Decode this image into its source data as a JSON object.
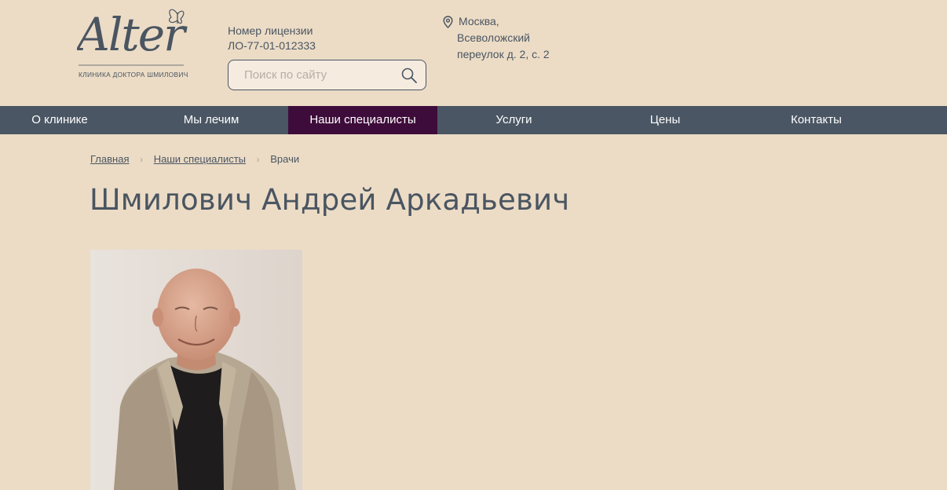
{
  "header": {
    "logo_text": "Alter",
    "logo_subtitle": "КЛИНИКА ДОКТОРА ШМИЛОВИЧА",
    "license_label": "Номер лицензии",
    "license_number": "ЛО-77-01-012333",
    "search": {
      "placeholder": "Поиск по сайту",
      "value": ""
    },
    "address": {
      "line1": "Москва,",
      "line2": "Всеволожский",
      "line3": "переулок д. 2, с. 2"
    }
  },
  "nav": {
    "items": [
      {
        "label": "О клинике"
      },
      {
        "label": "Мы лечим"
      },
      {
        "label": "Наши специалисты"
      },
      {
        "label": "Услуги"
      },
      {
        "label": "Цены"
      },
      {
        "label": "Контакты"
      }
    ],
    "active_label": "Наши специалисты"
  },
  "breadcrumb": {
    "home": "Главная",
    "section": "Наши специалисты",
    "current": "Врачи"
  },
  "page": {
    "title": "Шмилович Андрей Аркадьевич"
  },
  "colors": {
    "background": "#ecdcc6",
    "nav_background": "#4a5663",
    "nav_active": "#3e0c3a",
    "text": "#4a5561"
  },
  "icons": {
    "search": "search-icon",
    "location": "location-pin-icon",
    "breadcrumb_separator": "chevron-right-icon"
  }
}
